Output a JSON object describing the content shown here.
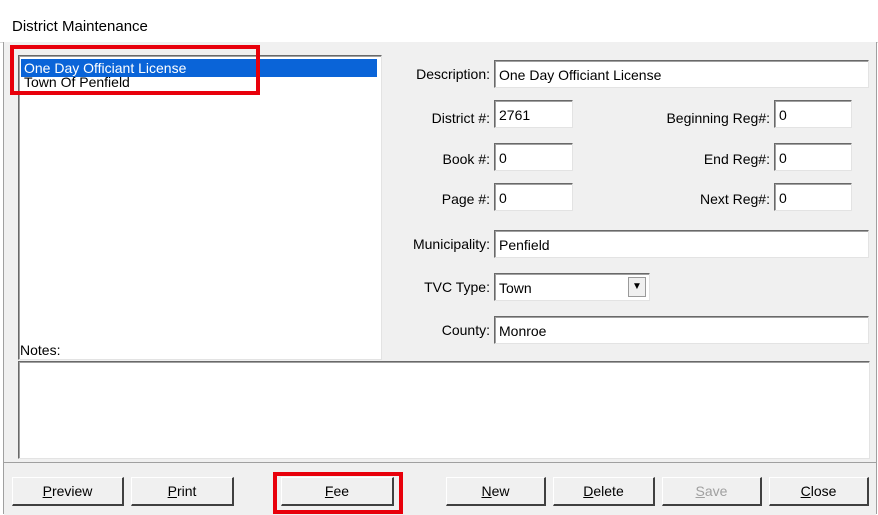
{
  "window": {
    "title": "District Maintenance"
  },
  "district_list": {
    "items": [
      {
        "label": "One Day Officiant License",
        "selected": true
      },
      {
        "label": "Town Of Penfield",
        "selected": false
      }
    ]
  },
  "form": {
    "description": {
      "label": "Description:",
      "value": "One Day Officiant License"
    },
    "district_no": {
      "label": "District #:",
      "value": "2761"
    },
    "book_no": {
      "label": "Book #:",
      "value": "0"
    },
    "page_no": {
      "label": "Page #:",
      "value": "0"
    },
    "beginning_reg": {
      "label": "Beginning Reg#:",
      "value": "0"
    },
    "end_reg": {
      "label": "End Reg#:",
      "value": "0"
    },
    "next_reg": {
      "label": "Next Reg#:",
      "value": "0"
    },
    "municipality": {
      "label": "Municipality:",
      "value": "Penfield"
    },
    "tvc_type": {
      "label": "TVC Type:",
      "value": "Town"
    },
    "county": {
      "label": "County:",
      "value": "Monroe"
    },
    "notes": {
      "label": "Notes:",
      "value": ""
    }
  },
  "buttons": {
    "preview": {
      "mnemonic": "P",
      "rest": "review"
    },
    "print": {
      "mnemonic": "P",
      "rest": "rint"
    },
    "fee": {
      "mnemonic": "F",
      "rest": "ee"
    },
    "new": {
      "mnemonic": "N",
      "rest": "ew"
    },
    "delete": {
      "mnemonic": "D",
      "rest": "elete"
    },
    "save": {
      "mnemonic": "S",
      "rest": "ave",
      "enabled": false
    },
    "close": {
      "mnemonic": "C",
      "rest": "lose"
    }
  },
  "colors": {
    "highlight": "#e8000b",
    "selection": "#0a64d8"
  }
}
